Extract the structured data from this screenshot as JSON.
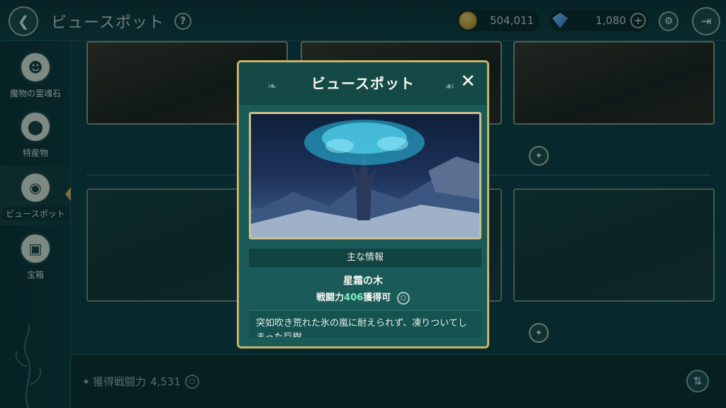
{
  "header": {
    "back_icon": "back-arrow-icon",
    "title": "ビュースポット",
    "help": "?",
    "gold": "504,011",
    "gems": "1,080",
    "plus": "+"
  },
  "sidebar": {
    "items": [
      {
        "label": "魔物の霊魂石",
        "icon": "monster-soul-icon"
      },
      {
        "label": "特産物",
        "icon": "specialty-icon"
      },
      {
        "label": "ビュースポット",
        "icon": "viewspot-icon"
      },
      {
        "label": "宝箱",
        "icon": "treasure-chest-icon"
      }
    ]
  },
  "footer": {
    "power_label": "獲得戦闘力",
    "power_value": "4,531"
  },
  "modal": {
    "title": "ビュースポット",
    "close": "✕",
    "section_header": "主な情報",
    "spot_name": "星霜の木",
    "power_prefix": "戦闘力",
    "power_value": "406",
    "power_suffix": "獲得可",
    "description": "突如吹き荒れた氷の嵐に耐えられず、凍りついてしまった巨樹"
  },
  "colors": {
    "accent_gold": "#c9b26b",
    "highlight_green": "#7ff2c0",
    "panel_teal": "#1a5a58"
  }
}
